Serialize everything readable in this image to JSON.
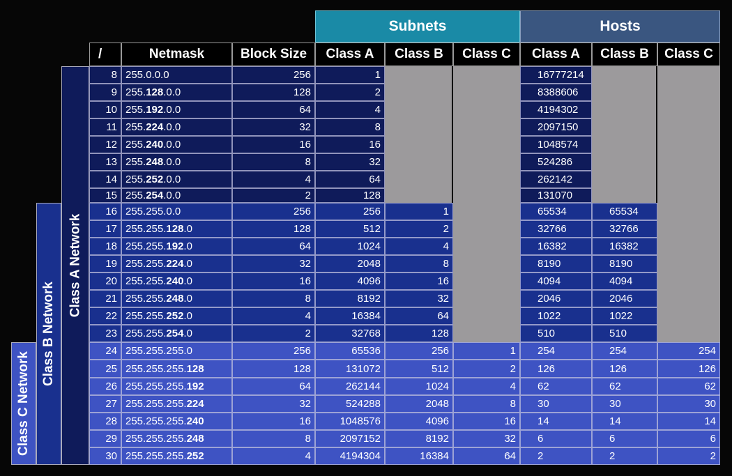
{
  "group_headers": {
    "subnets": "Subnets",
    "hosts": "Hosts"
  },
  "column_headers": [
    "/",
    "Netmask",
    "Block Size",
    "Class A",
    "Class B",
    "Class C",
    "Class A",
    "Class B",
    "Class C"
  ],
  "row_labels": {
    "class_a": "Class A Network",
    "class_b": "Class B Network",
    "class_c": "Class C Network"
  },
  "rows": [
    {
      "prefix": "8",
      "netmask": "255.0.0.0",
      "block": "256",
      "sa": "1",
      "sb": "",
      "sc": "",
      "ha": "16777214",
      "hb": "",
      "hc": ""
    },
    {
      "prefix": "9",
      "netmask": "255.128.0.0",
      "block": "128",
      "sa": "2",
      "sb": "",
      "sc": "",
      "ha": "8388606",
      "hb": "",
      "hc": ""
    },
    {
      "prefix": "10",
      "netmask": "255.192.0.0",
      "block": "64",
      "sa": "4",
      "sb": "",
      "sc": "",
      "ha": "4194302",
      "hb": "",
      "hc": ""
    },
    {
      "prefix": "11",
      "netmask": "255.224.0.0",
      "block": "32",
      "sa": "8",
      "sb": "",
      "sc": "",
      "ha": "2097150",
      "hb": "",
      "hc": ""
    },
    {
      "prefix": "12",
      "netmask": "255.240.0.0",
      "block": "16",
      "sa": "16",
      "sb": "",
      "sc": "",
      "ha": "1048574",
      "hb": "",
      "hc": ""
    },
    {
      "prefix": "13",
      "netmask": "255.248.0.0",
      "block": "8",
      "sa": "32",
      "sb": "",
      "sc": "",
      "ha": "524286",
      "hb": "",
      "hc": ""
    },
    {
      "prefix": "14",
      "netmask": "255.252.0.0",
      "block": "4",
      "sa": "64",
      "sb": "",
      "sc": "",
      "ha": "262142",
      "hb": "",
      "hc": ""
    },
    {
      "prefix": "15",
      "netmask": "255.254.0.0",
      "block": "2",
      "sa": "128",
      "sb": "",
      "sc": "",
      "ha": "131070",
      "hb": "",
      "hc": ""
    },
    {
      "prefix": "16",
      "netmask": "255.255.0.0",
      "block": "256",
      "sa": "256",
      "sb": "1",
      "sc": "",
      "ha": "65534",
      "hb": "65534",
      "hc": ""
    },
    {
      "prefix": "17",
      "netmask": "255.255.128.0",
      "block": "128",
      "sa": "512",
      "sb": "2",
      "sc": "",
      "ha": "32766",
      "hb": "32766",
      "hc": ""
    },
    {
      "prefix": "18",
      "netmask": "255.255.192.0",
      "block": "64",
      "sa": "1024",
      "sb": "4",
      "sc": "",
      "ha": "16382",
      "hb": "16382",
      "hc": ""
    },
    {
      "prefix": "19",
      "netmask": "255.255.224.0",
      "block": "32",
      "sa": "2048",
      "sb": "8",
      "sc": "",
      "ha": "8190",
      "hb": "8190",
      "hc": ""
    },
    {
      "prefix": "20",
      "netmask": "255.255.240.0",
      "block": "16",
      "sa": "4096",
      "sb": "16",
      "sc": "",
      "ha": "4094",
      "hb": "4094",
      "hc": ""
    },
    {
      "prefix": "21",
      "netmask": "255.255.248.0",
      "block": "8",
      "sa": "8192",
      "sb": "32",
      "sc": "",
      "ha": "2046",
      "hb": "2046",
      "hc": ""
    },
    {
      "prefix": "22",
      "netmask": "255.255.252.0",
      "block": "4",
      "sa": "16384",
      "sb": "64",
      "sc": "",
      "ha": "1022",
      "hb": "1022",
      "hc": ""
    },
    {
      "prefix": "23",
      "netmask": "255.255.254.0",
      "block": "2",
      "sa": "32768",
      "sb": "128",
      "sc": "",
      "ha": "510",
      "hb": "510",
      "hc": ""
    },
    {
      "prefix": "24",
      "netmask": "255.255.255.0",
      "block": "256",
      "sa": "65536",
      "sb": "256",
      "sc": "1",
      "ha": "254",
      "hb": "254",
      "hc": "254"
    },
    {
      "prefix": "25",
      "netmask": "255.255.255.128",
      "block": "128",
      "sa": "131072",
      "sb": "512",
      "sc": "2",
      "ha": "126",
      "hb": "126",
      "hc": "126"
    },
    {
      "prefix": "26",
      "netmask": "255.255.255.192",
      "block": "64",
      "sa": "262144",
      "sb": "1024",
      "sc": "4",
      "ha": "62",
      "hb": "62",
      "hc": "62"
    },
    {
      "prefix": "27",
      "netmask": "255.255.255.224",
      "block": "32",
      "sa": "524288",
      "sb": "2048",
      "sc": "8",
      "ha": "30",
      "hb": "30",
      "hc": "30"
    },
    {
      "prefix": "28",
      "netmask": "255.255.255.240",
      "block": "16",
      "sa": "1048576",
      "sb": "4096",
      "sc": "16",
      "ha": "14",
      "hb": "14",
      "hc": "14"
    },
    {
      "prefix": "29",
      "netmask": "255.255.255.248",
      "block": "8",
      "sa": "2097152",
      "sb": "8192",
      "sc": "32",
      "ha": "6",
      "hb": "6",
      "hc": "6"
    },
    {
      "prefix": "30",
      "netmask": "255.255.255.252",
      "block": "4",
      "sa": "4194304",
      "sb": "16384",
      "sc": "64",
      "ha": "2",
      "hb": "2",
      "hc": "2"
    }
  ],
  "colors": {
    "background": "#060606",
    "subnets_header": "#1a8aa6",
    "hosts_header": "#3a5680",
    "class_a_band": "#0f1b5a",
    "class_b_band": "#19308e",
    "class_c_band": "#3e53c3",
    "na_gray": "#9c9a9c"
  }
}
